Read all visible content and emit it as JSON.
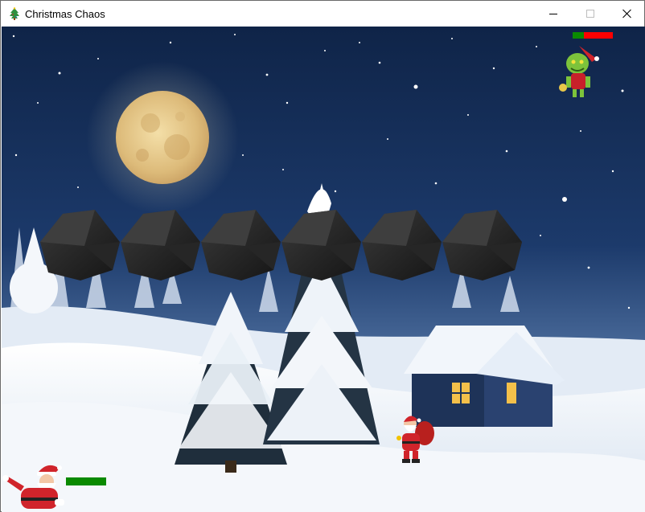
{
  "window": {
    "title": "Christmas Chaos",
    "controls": [
      "minimize",
      "maximize",
      "close"
    ]
  },
  "game": {
    "player": {
      "sprite": "santa-claus",
      "health_fraction": 1.0,
      "health_color": "#0a8a00"
    },
    "enemy": {
      "sprite": "grinch",
      "health_fraction": 0.28,
      "health_color": "#0a8a00",
      "damage_color": "#ff0000"
    },
    "bystander": {
      "sprite": "santa-with-sack"
    },
    "obstacles": [
      {
        "kind": "coal-lump"
      },
      {
        "kind": "coal-lump"
      },
      {
        "kind": "coal-lump"
      },
      {
        "kind": "coal-lump"
      },
      {
        "kind": "coal-lump"
      },
      {
        "kind": "coal-lump"
      }
    ],
    "background": {
      "theme": "snowy-night",
      "elements": [
        "full-moon",
        "snowy-pine-trees",
        "snow-covered-house",
        "town-lights",
        "falling-snow"
      ],
      "sky_color": "#1c3a6b",
      "snow_color": "#eef3f9"
    }
  }
}
